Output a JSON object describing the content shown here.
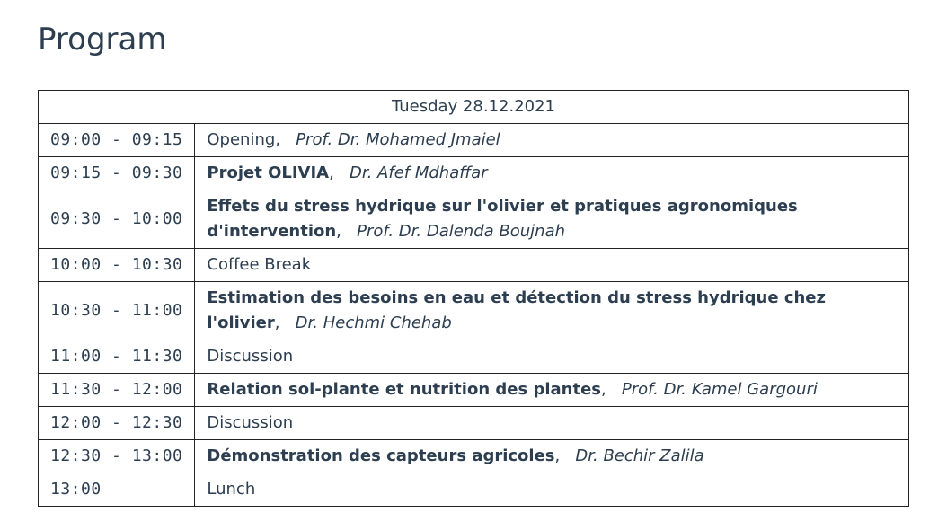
{
  "page": {
    "title": "Program"
  },
  "program": {
    "day": "Tuesday 28.12.2021",
    "rows": [
      {
        "time": "09:00 - 09:15",
        "title": "Opening",
        "bold": false,
        "speaker": "Prof. Dr. Mohamed Jmaiel"
      },
      {
        "time": "09:15 - 09:30",
        "title": "Projet OLIVIA",
        "bold": true,
        "speaker": "Dr. Afef Mdhaffar"
      },
      {
        "time": "09:30 - 10:00",
        "title": "Effets du stress hydrique sur l'olivier et pratiques agronomiques d'intervention",
        "bold": true,
        "speaker": "Prof. Dr. Dalenda Boujnah"
      },
      {
        "time": "10:00 - 10:30",
        "title": "Coffee Break",
        "bold": false,
        "speaker": ""
      },
      {
        "time": "10:30 - 11:00",
        "title": "Estimation des besoins en eau et détection du stress hydrique chez l'olivier",
        "bold": true,
        "speaker": "Dr. Hechmi Chehab"
      },
      {
        "time": "11:00 - 11:30",
        "title": "Discussion",
        "bold": false,
        "speaker": ""
      },
      {
        "time": "11:30 - 12:00",
        "title": "Relation sol-plante et nutrition des plantes",
        "bold": true,
        "speaker": "Prof. Dr. Kamel Gargouri"
      },
      {
        "time": "12:00 - 12:30",
        "title": "Discussion",
        "bold": false,
        "speaker": ""
      },
      {
        "time": "12:30 - 13:00",
        "title": "Démonstration des capteurs agricoles",
        "bold": true,
        "speaker": "Dr. Bechir Zalila"
      },
      {
        "time": "13:00",
        "title": "Lunch",
        "bold": false,
        "speaker": ""
      }
    ]
  }
}
